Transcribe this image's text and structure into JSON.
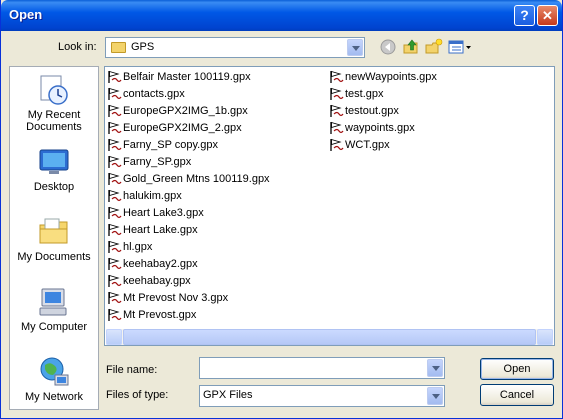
{
  "window": {
    "title": "Open"
  },
  "toolbar": {
    "lookin_label": "Look in:",
    "lookin_value": "GPS"
  },
  "places": [
    {
      "label": "My Recent Documents",
      "icon": "recent-documents-icon"
    },
    {
      "label": "Desktop",
      "icon": "desktop-icon"
    },
    {
      "label": "My Documents",
      "icon": "my-documents-icon"
    },
    {
      "label": "My Computer",
      "icon": "my-computer-icon"
    },
    {
      "label": "My Network",
      "icon": "my-network-icon"
    }
  ],
  "files": [
    "Belfair Master 100119.gpx",
    "contacts.gpx",
    "EuropeGPX2IMG_1b.gpx",
    "EuropeGPX2IMG_2.gpx",
    "Farny_SP copy.gpx",
    "Farny_SP.gpx",
    "Gold_Green Mtns 100119.gpx",
    "halukim.gpx",
    "Heart Lake3.gpx",
    "Heart Lake.gpx",
    "hl.gpx",
    "keehabay2.gpx",
    "keehabay.gpx",
    "Mt Prevost Nov 3.gpx",
    "Mt Prevost.gpx",
    "newWaypoints.gpx",
    "test.gpx",
    "testout.gpx",
    "waypoints.gpx",
    "WCT.gpx"
  ],
  "form": {
    "filename_label": "File name:",
    "filename_value": "",
    "filetype_label": "Files of type:",
    "filetype_value": "GPX Files"
  },
  "buttons": {
    "open": "Open",
    "cancel": "Cancel"
  },
  "colors": {
    "titlebar": "#0058e6",
    "dialog_bg": "#ece9d8",
    "border": "#7f9db9"
  }
}
